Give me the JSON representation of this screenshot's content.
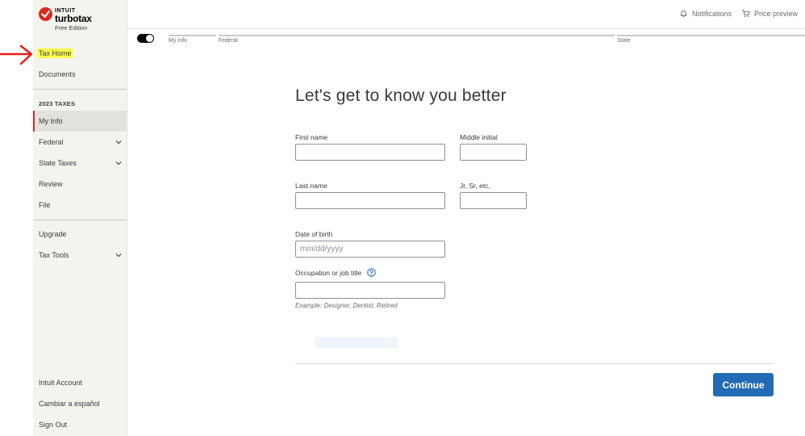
{
  "brand": {
    "logo_top": "INTUIT",
    "logo_name": "turbotax",
    "edition": "Free Edition"
  },
  "sidebar": {
    "tax_home": "Tax Home",
    "documents": "Documents",
    "section_heading": "2023 TAXES",
    "items": [
      {
        "label": "My Info"
      },
      {
        "label": "Federal"
      },
      {
        "label": "State Taxes"
      },
      {
        "label": "Review"
      },
      {
        "label": "File"
      }
    ],
    "upgrade": "Upgrade",
    "tax_tools": "Tax Tools",
    "footer": [
      {
        "label": "Intuit Account"
      },
      {
        "label": "Cambiar a español"
      },
      {
        "label": "Sign Out"
      }
    ]
  },
  "header": {
    "notifications": "Notifications",
    "price_preview": "Price preview"
  },
  "progress": {
    "steps": [
      "My Info",
      "Federal",
      "State"
    ]
  },
  "form": {
    "title": "Let's get to know you better",
    "first_name_label": "First name",
    "middle_initial_label": "Middle initial",
    "last_name_label": "Last name",
    "suffix_label": "Jr, Sr, etc.",
    "dob_label": "Date of birth",
    "dob_placeholder": "mm/dd/yyyy",
    "occupation_label": "Occupation or job title",
    "occupation_hint": "Example: Designer, Dentist, Retired",
    "continue_label": "Continue"
  },
  "colors": {
    "accent": "#236cb5",
    "active_marker": "#d52b1e",
    "highlight": "#ffff4d",
    "annotation_arrow": "#e0201b"
  }
}
